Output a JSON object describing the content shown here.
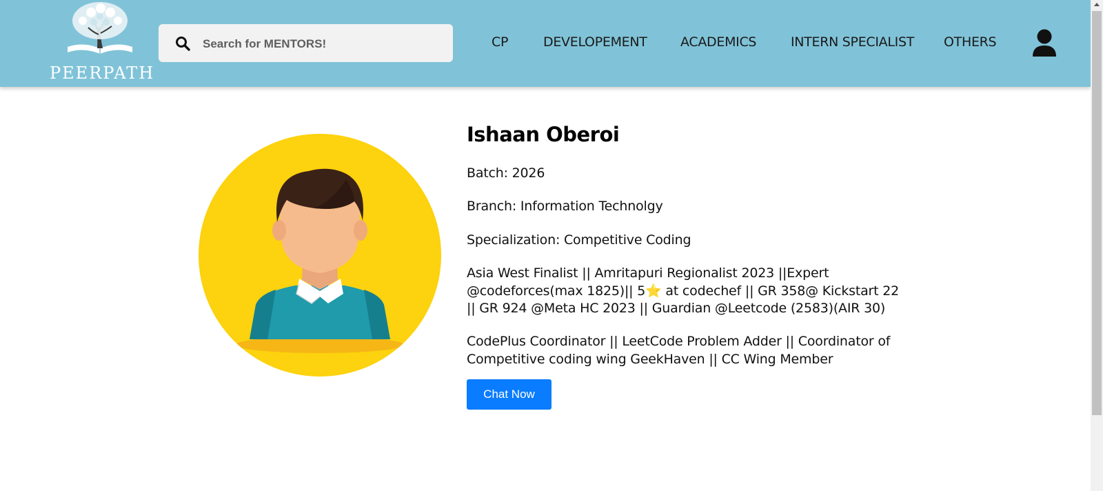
{
  "header": {
    "logo_text": "PEERPATH",
    "search": {
      "placeholder": "Search for MENTORS!"
    },
    "nav": [
      "CP",
      "DEVELOPEMENT",
      "ACADEMICS",
      "INTERN SPECIALIST",
      "OTHERS"
    ]
  },
  "profile": {
    "name": "Ishaan Oberoi",
    "batch": "Batch: 2026",
    "branch": "Branch: Information Technolgy",
    "specialization": "Specialization: Competitive Coding",
    "achievements": "Asia West Finalist || Amritapuri Regionalist 2023 ||Expert @codeforces(max 1825)|| 5⭐ at codechef || GR 358@ Kickstart 22 || GR 924 @Meta HC 2023 || Guardian @Leetcode (2583)(AIR 30)",
    "roles": "CodePlus Coordinator || LeetCode Problem Adder || Coordinator of Competitive coding wing GeekHaven || CC Wing Member",
    "chat_button": "Chat Now"
  },
  "colors": {
    "header_bg": "#80c3d8",
    "button_bg": "#0a7cff",
    "avatar_bg": "#fdd20e"
  }
}
